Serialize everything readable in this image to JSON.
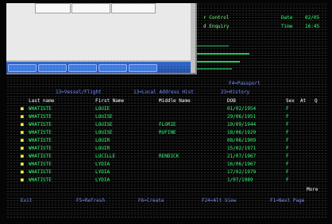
{
  "header": {
    "top_right_line1_left": "r Control",
    "top_right_line2_left": "d Enquiry",
    "date_label": "Date",
    "date_value": "02/05",
    "time_label": "Time",
    "time_value": "16:45"
  },
  "labels": {
    "f4_passport": "F4=Passport",
    "f1": "13=Vessel/Flight",
    "f2": "13=Local Address Hist",
    "f3": "23=History"
  },
  "table": {
    "headers": [
      "Last name",
      "First Name",
      "Middle Name",
      "DOB",
      "Sex",
      "At",
      "Q"
    ],
    "rows": [
      {
        "last": "WHATISTE",
        "first": "LOUIE",
        "middle": "",
        "dob": "01/02/1954",
        "sex": "F"
      },
      {
        "last": "WHATISTE",
        "first": "LOUISE",
        "middle": "",
        "dob": "29/06/1951",
        "sex": "F"
      },
      {
        "last": "WHATISTE",
        "first": "LOUISE",
        "middle": "FLORIE",
        "dob": "19/09/1944",
        "sex": "F"
      },
      {
        "last": "WHATISTE",
        "first": "LOUISE",
        "middle": "RUFINE",
        "dob": "18/06/1929",
        "sex": "F"
      },
      {
        "last": "WHATISTE",
        "first": "LOUIR",
        "middle": "",
        "dob": "08/06/1909",
        "sex": "F"
      },
      {
        "last": "WHATISTE",
        "first": "LOUIR",
        "middle": "",
        "dob": "15/02/1971",
        "sex": "F"
      },
      {
        "last": "WHATISTE",
        "first": "LUCILLE",
        "middle": "RENDICK",
        "dob": "21/07/1967",
        "sex": "F"
      },
      {
        "last": "WHATISTE",
        "first": "LYDIA",
        "middle": "",
        "dob": "16/06/1967",
        "sex": "F"
      },
      {
        "last": "WHATISTE",
        "first": "LYDIA",
        "middle": "",
        "dob": "17/02/1979",
        "sex": "F"
      },
      {
        "last": "WHATISTE",
        "first": "LYDIA",
        "middle": "",
        "dob": "1/07/1989",
        "sex": "F"
      }
    ]
  },
  "footer": {
    "more": "More",
    "keys": [
      "Exit",
      "F5=Refresh",
      "F6=Create",
      "F24=Alt View",
      "F1=Next Page"
    ]
  }
}
